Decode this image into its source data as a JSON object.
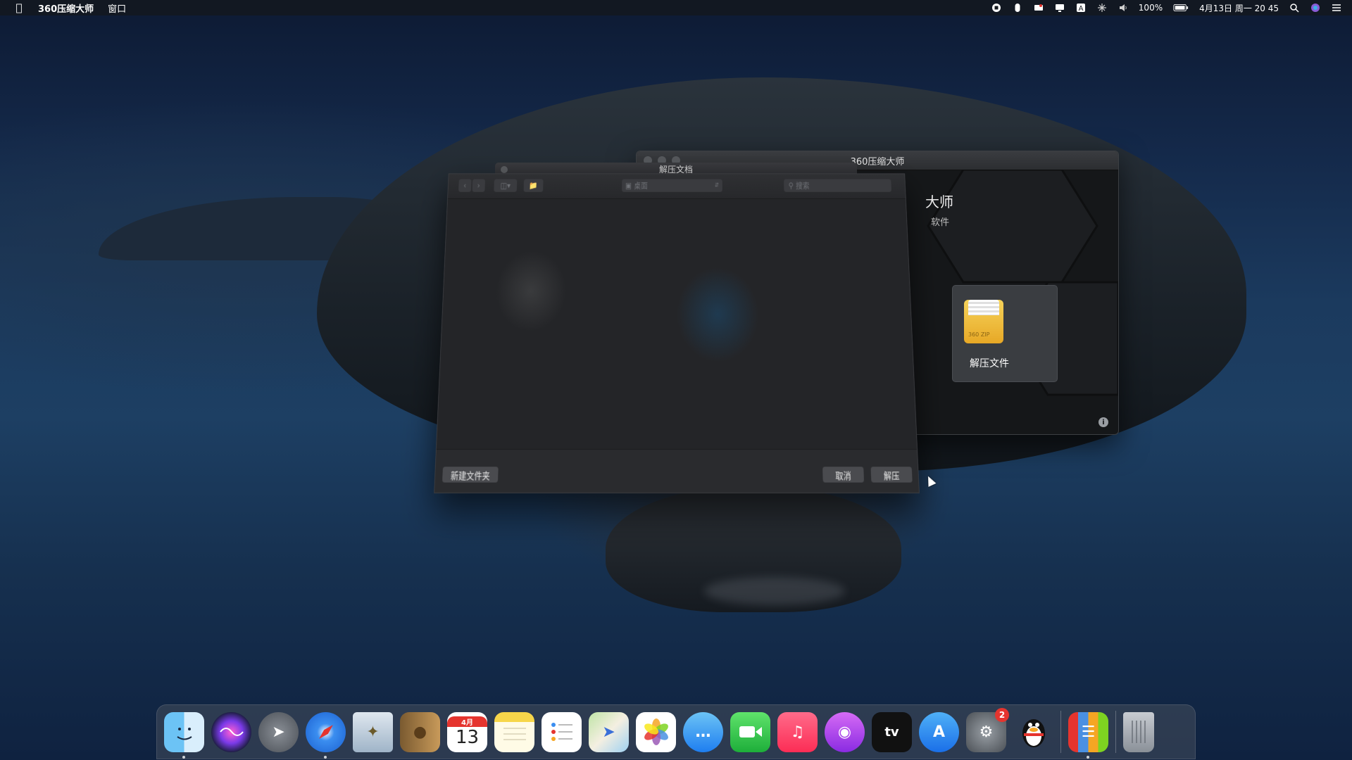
{
  "menubar": {
    "app_name": "360压缩大师",
    "menus": [
      "窗口"
    ],
    "battery": "100%",
    "datetime": "4月13日 周一  20 45",
    "icons": [
      "record-icon",
      "mouse-icon",
      "cast-icon",
      "display-icon",
      "input-a-icon",
      "network-icon",
      "volume-icon",
      "battery-icon",
      "search-icon",
      "siri-icon",
      "list-icon"
    ]
  },
  "window360": {
    "title": "360压缩大师",
    "brand": "大师",
    "brand_sub": "软件",
    "card_label": "解压文件",
    "zip_tag": "360 ZIP",
    "info": "i"
  },
  "dialog": {
    "title": "解压文档",
    "location": "桌面",
    "search_placeholder": "搜索",
    "new_folder": "新建文件夹",
    "cancel": "取消",
    "extract": "解压"
  },
  "dock": {
    "calendar_month": "4月",
    "calendar_day": "13",
    "settings_badge": "2",
    "apps": [
      "finder",
      "siri",
      "launchpad",
      "safari",
      "mail",
      "contacts",
      "calendar",
      "notes",
      "reminders",
      "maps",
      "photos",
      "messages",
      "facetime",
      "music",
      "podcasts",
      "tv",
      "app-store",
      "system-preferences",
      "qq",
      "360-zip",
      "trash"
    ],
    "tv_label": "tv"
  },
  "colors": {
    "menubar_bg": "#14181e",
    "window_bg": "#151719",
    "dialog_bg": "#232427",
    "button_bg": "#4a4b4f",
    "zip_yellow": "#f6d35a",
    "badge_red": "#e5342e"
  }
}
